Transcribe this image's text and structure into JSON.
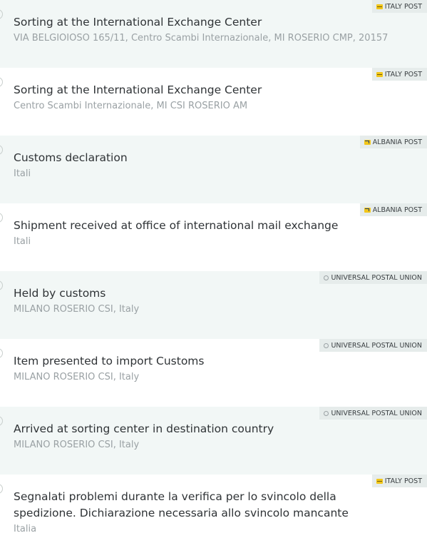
{
  "events": [
    {
      "title": "Sorting at the International Exchange Center",
      "location": "VIA BELGIOIOSO 165/11, Centro Scambi Internazionale, MI ROSERIO CMP, 20157",
      "carrier": "ITALY POST",
      "carrier_icon": "italy-post-logo-icon"
    },
    {
      "title": "Sorting at the International Exchange Center",
      "location": "Centro Scambi Internazionale, MI CSI ROSERIO AM",
      "carrier": "ITALY POST",
      "carrier_icon": "italy-post-logo-icon"
    },
    {
      "title": "Customs declaration",
      "location": "Itali",
      "carrier": "ALBANIA POST",
      "carrier_icon": "albania-post-logo-icon"
    },
    {
      "title": "Shipment received at office of international mail exchange",
      "location": "Itali",
      "carrier": "ALBANIA POST",
      "carrier_icon": "albania-post-logo-icon"
    },
    {
      "title": "Held by customs",
      "location": "MILANO ROSERIO CSI, Italy",
      "carrier": "UNIVERSAL POSTAL UNION",
      "carrier_icon": "upu-logo-icon"
    },
    {
      "title": "Item presented to import Customs",
      "location": "MILANO ROSERIO CSI, Italy",
      "carrier": "UNIVERSAL POSTAL UNION",
      "carrier_icon": "upu-logo-icon"
    },
    {
      "title": "Arrived at sorting center in destination country",
      "location": "MILANO ROSERIO CSI, Italy",
      "carrier": "UNIVERSAL POSTAL UNION",
      "carrier_icon": "upu-logo-icon"
    },
    {
      "title": "Segnalati problemi durante la verifica per lo svincolo della spedizione. Dichiarazione necessaria allo svincolo mancante",
      "location": "Italia",
      "carrier": "ITALY POST",
      "carrier_icon": "italy-post-logo-icon"
    }
  ],
  "colors": {
    "shaded_row": "#f2f7f6",
    "badge_bg": "#e6eceb",
    "title_text": "#2f3336",
    "location_text": "#9aa1a4",
    "post_yellow": "#f2c619"
  }
}
